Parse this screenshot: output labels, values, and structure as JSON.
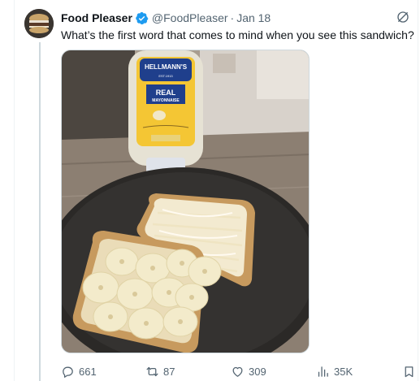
{
  "tweet": {
    "author": {
      "display_name": "Food Pleaser",
      "handle": "@FoodPleaser",
      "verified": true,
      "avatar_icon": "burger-avatar"
    },
    "separator": "·",
    "date": "Jan 18",
    "text": "What’s the first word that comes to mind when you see this sandwich?",
    "media": {
      "label": "photo of banana and mayonnaise sandwich",
      "bottle_brand": "HELLMANN'S",
      "bottle_est": "EST.1913",
      "bottle_product": "REAL",
      "bottle_product_sub": "MAYONNAISE"
    },
    "actions": {
      "replies": "661",
      "reposts": "87",
      "likes": "309",
      "views": "35K"
    }
  },
  "colors": {
    "accent_blue": "#1d9bf0",
    "muted_text": "#536471",
    "primary_text": "#0f1419"
  },
  "icons": {
    "verified": "verified-badge-icon",
    "grok": "grok-icon",
    "reply": "reply-icon",
    "repost": "repost-icon",
    "like": "heart-icon",
    "views": "views-icon",
    "bookmark": "bookmark-icon"
  }
}
